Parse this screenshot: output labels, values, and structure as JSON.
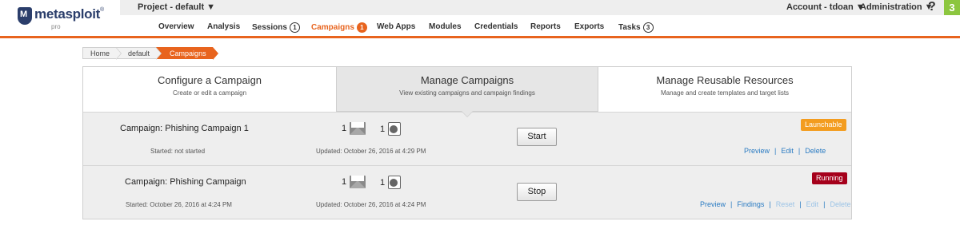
{
  "app": {
    "logo_text": "metasploit",
    "logo_trademark": "®",
    "logo_sub": "pro"
  },
  "header": {
    "project": "Project - default ▼",
    "account": "Account - tdoan ▼",
    "administration": "Administration ▼",
    "help": "?",
    "tasks_badge": "3",
    "accent_color": "#e8641e",
    "badge_color": "#8cc63f"
  },
  "nav": {
    "overview": "Overview",
    "analysis": "Analysis",
    "sessions": "Sessions",
    "sessions_count": "1",
    "campaigns": "Campaigns",
    "campaigns_count": "1",
    "web_apps": "Web Apps",
    "modules": "Modules",
    "credentials": "Credentials",
    "reports": "Reports",
    "exports": "Exports",
    "tasks": "Tasks",
    "tasks_count": "3"
  },
  "breadcrumb": {
    "home": "Home",
    "project": "default",
    "current": "Campaigns"
  },
  "tabs": {
    "configure": {
      "title": "Configure a Campaign",
      "subtitle": "Create or edit a campaign"
    },
    "manage": {
      "title": "Manage Campaigns",
      "subtitle": "View existing campaigns and campaign findings"
    },
    "resources": {
      "title": "Manage Reusable Resources",
      "subtitle": "Manage and create templates and target lists"
    }
  },
  "campaigns": [
    {
      "name": "Campaign: Phishing Campaign 1",
      "started": "Started: not started",
      "updated": "Updated: October 26, 2016 at 4:29 PM",
      "email_count": "1",
      "web_count": "1",
      "button": "Start",
      "status": "Launchable",
      "status_color": "#f39c1f",
      "actions": {
        "preview": "Preview",
        "edit": "Edit",
        "delete": "Delete"
      }
    },
    {
      "name": "Campaign: Phishing Campaign",
      "started": "Started: October 26, 2016 at 4:24 PM",
      "updated": "Updated: October 26, 2016 at 4:24 PM",
      "email_count": "1",
      "web_count": "1",
      "button": "Stop",
      "status": "Running",
      "status_color": "#a5001b",
      "actions": {
        "preview": "Preview",
        "findings": "Findings",
        "reset": "Reset",
        "edit": "Edit",
        "delete": "Delete"
      }
    }
  ],
  "separator": "|"
}
